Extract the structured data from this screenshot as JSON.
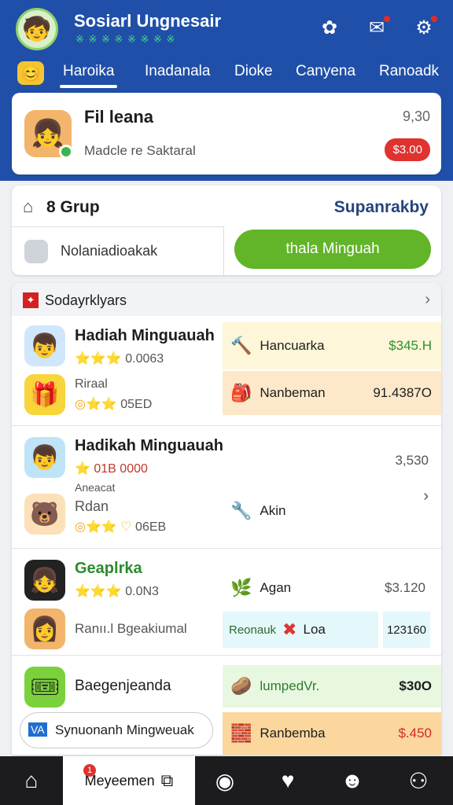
{
  "header": {
    "title": "Sosiarl Ungnesair",
    "subtitle": "※ ※ ※ ※ ※ ※ ※ ※",
    "icons": [
      "puzzle-icon",
      "chat-icon",
      "settings-icon"
    ]
  },
  "tabs": [
    {
      "label": "Haroika",
      "active": true
    },
    {
      "label": "Inadanala",
      "active": false
    },
    {
      "label": "Dioke",
      "active": false
    },
    {
      "label": "Canyena",
      "active": false
    },
    {
      "label": "Ranoadk",
      "active": false
    }
  ],
  "profile": {
    "name": "Fil leana",
    "subtitle": "Madcle re Saktaral",
    "value": "9,30",
    "badge": "$3.00"
  },
  "group": {
    "title": "8 Grup",
    "link": "Supanrakby",
    "input_value": "Nolaniadioakak",
    "button_label": "thala Minguah"
  },
  "list": {
    "title": "Sodayrklyars",
    "rows": [
      {
        "name": "Hadiah Minguauah",
        "stars_text": "0.0063",
        "sub": "Riraal",
        "sub_stars": "05ED",
        "items": [
          {
            "icon": "🔨",
            "label": "Hancuarka",
            "amount": "$345.H"
          },
          {
            "icon": "🎒",
            "label": "Nanbeman",
            "amount": "91.4387O"
          }
        ]
      },
      {
        "name": "Hadikah Minguauah",
        "stars_text": "01B 0000",
        "sub_pre": "Aneacat",
        "sub": "Rdan",
        "sub_stars": "06EB",
        "value": "3,530",
        "items": [
          {
            "icon": "🔧",
            "label": "Akin",
            "amount": ""
          }
        ]
      },
      {
        "name": "Geaplrka",
        "stars_text": "0.0N3",
        "sub": "Ranıı.l Bgeakiumal",
        "items": [
          {
            "icon": "🌿",
            "label": "Agan",
            "amount": "$3.120"
          },
          {
            "icon": "✖",
            "label_pre": "Reonauk",
            "label": "Loa",
            "amount": "123160"
          }
        ]
      },
      {
        "name": "Baegenjeanda",
        "input_prefix": "VA",
        "input_text": "Synuonanh Mingweuak",
        "items": [
          {
            "icon": "🥔",
            "label": "lumpedVr.",
            "amount": "$30O"
          },
          {
            "icon": "🧱",
            "label": "Ranbemba",
            "amount": "$.450"
          }
        ]
      }
    ]
  },
  "bottom_nav": {
    "active_label": "Meyeemen",
    "active_badge": "1"
  },
  "colors": {
    "header_bg": "#1f4fa8",
    "accent_green": "#62b429",
    "badge_red": "#e0322f"
  }
}
